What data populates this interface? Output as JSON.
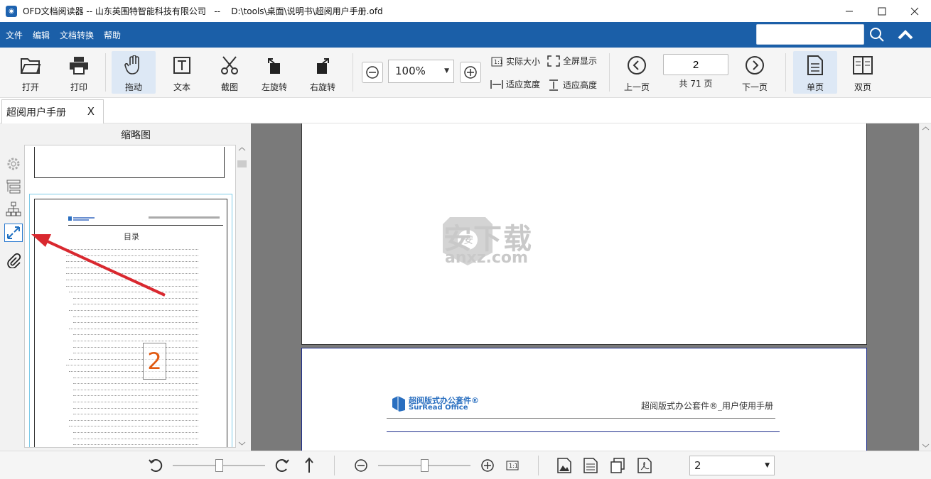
{
  "window": {
    "title": "OFD文档阅读器 -- 山东英围特智能科技有限公司   --    D:\\tools\\桌面\\说明书\\超阅用户手册.ofd",
    "app_icon": "ofd-app-icon"
  },
  "menu": {
    "items": [
      "文件",
      "编辑",
      "文档转换",
      "帮助"
    ],
    "search_placeholder": ""
  },
  "toolbar": {
    "open": "打开",
    "print": "打印",
    "drag": "拖动",
    "text": "文本",
    "screenshot": "截图",
    "rotate_left": "左旋转",
    "rotate_right": "右旋转",
    "zoom_value": "100%",
    "actual_size": "实际大小",
    "fullscreen": "全屏显示",
    "fit_width": "适应宽度",
    "fit_height": "适应高度",
    "prev_page": "上一页",
    "current_page": "2",
    "total_pages": "共 71 页",
    "next_page": "下一页",
    "single_page": "单页",
    "double_page": "双页"
  },
  "tabs": [
    {
      "label": "超阅用户手册",
      "close": "X"
    }
  ],
  "thumbnail_panel": {
    "title": "缩略图",
    "toc_title": "目录",
    "page_badge": "2"
  },
  "document": {
    "watermark_cn": "安下载",
    "watermark_en": "anxz.com",
    "logo_cn": "超阅版式办公套件®",
    "logo_en": "SurRead Office",
    "header_title": "超阅版式办公套件®_用户使用手册"
  },
  "statusbar": {
    "page_select_value": "2"
  },
  "colors": {
    "menubar": "#1b5fa8",
    "active_tool": "#dde8f5",
    "arrow": "#d9282f",
    "badge": "#e05a12"
  }
}
